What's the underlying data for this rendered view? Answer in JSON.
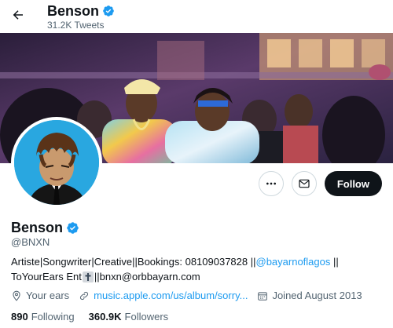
{
  "header": {
    "name": "Benson",
    "tweets": "31.2K Tweets"
  },
  "profile": {
    "name": "Benson",
    "handle": "@BNXN",
    "bio_part1": "Artiste|Songwriter|Creative||Bookings: 08109037828 ||",
    "bio_mention": "@bayarnoflagos",
    "bio_part2": " || ToYourEars Ent",
    "bio_part3": "||bnxn@orbbayarn.com",
    "location": "Your ears",
    "website": "music.apple.com/us/album/sorry...",
    "joined": "Joined August 2013",
    "following_count": "890",
    "following_label": "Following",
    "followers_count": "360.9K",
    "followers_label": "Followers"
  },
  "actions": {
    "follow_label": "Follow"
  },
  "icons": {
    "back": "arrow-left-icon",
    "verified": "verified-badge-icon",
    "more": "more-dots-icon",
    "message": "envelope-icon",
    "location": "location-pin-icon",
    "link": "link-icon",
    "calendar": "calendar-icon",
    "bio_emoji": "latin-cross-emoji"
  },
  "colors": {
    "accent": "#1d9bf0",
    "text": "#0f1419",
    "secondary": "#536471",
    "follow_bg": "#0f1419"
  }
}
